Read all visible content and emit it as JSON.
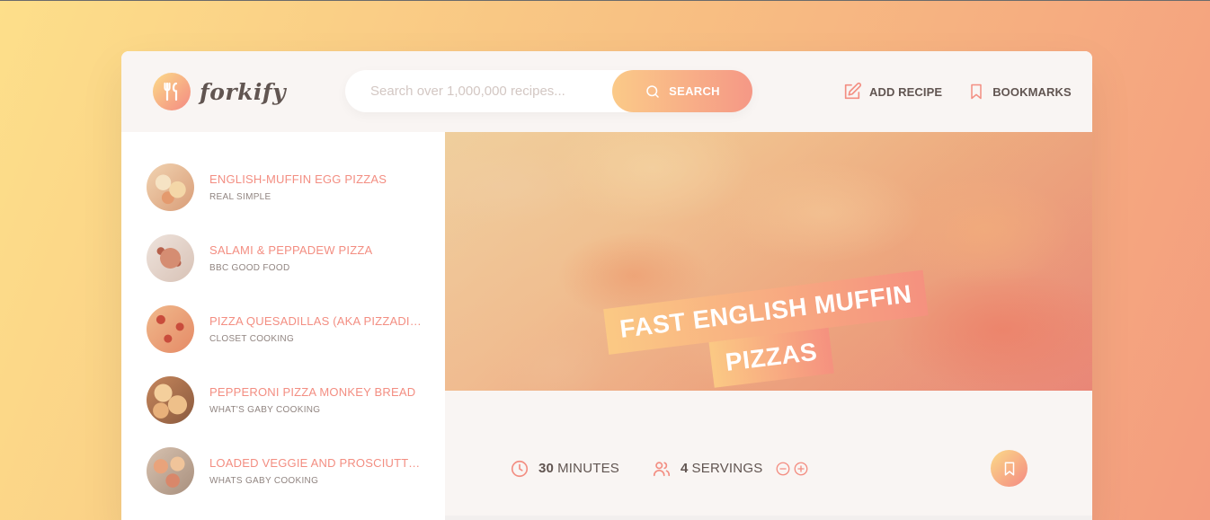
{
  "app": {
    "name": "forkify"
  },
  "search": {
    "placeholder": "Search over 1,000,000 recipes...",
    "button_label": "SEARCH"
  },
  "nav": {
    "add_recipe": "ADD RECIPE",
    "bookmarks": "BOOKMARKS"
  },
  "results": [
    {
      "title": "ENGLISH-MUFFIN EGG PIZZAS",
      "publisher": "REAL SIMPLE",
      "thumb": "egg-pizza"
    },
    {
      "title": "SALAMI & PEPPADEW PIZZA",
      "publisher": "BBC GOOD FOOD",
      "thumb": "salami-pizza"
    },
    {
      "title": "PIZZA QUESADILLAS (AKA PIZZADILLAS)",
      "publisher": "CLOSET COOKING",
      "thumb": "quesadilla"
    },
    {
      "title": "PEPPERONI PIZZA MONKEY BREAD",
      "publisher": "WHAT'S GABY COOKING",
      "thumb": "monkey-bread"
    },
    {
      "title": "LOADED VEGGIE AND PROSCIUTTO PIZZA",
      "publisher": "WHATS GABY COOKING",
      "thumb": "veggie-pizza"
    }
  ],
  "recipe": {
    "title_line1": "FAST ENGLISH MUFFIN",
    "title_line2": "PIZZAS",
    "minutes_value": "30",
    "minutes_label": "MINUTES",
    "servings_value": "4",
    "servings_label": "SERVINGS"
  },
  "colors": {
    "accent": "#f38e82",
    "gradient_start": "#fbdb89",
    "gradient_end": "#f48982",
    "text": "#615551"
  }
}
